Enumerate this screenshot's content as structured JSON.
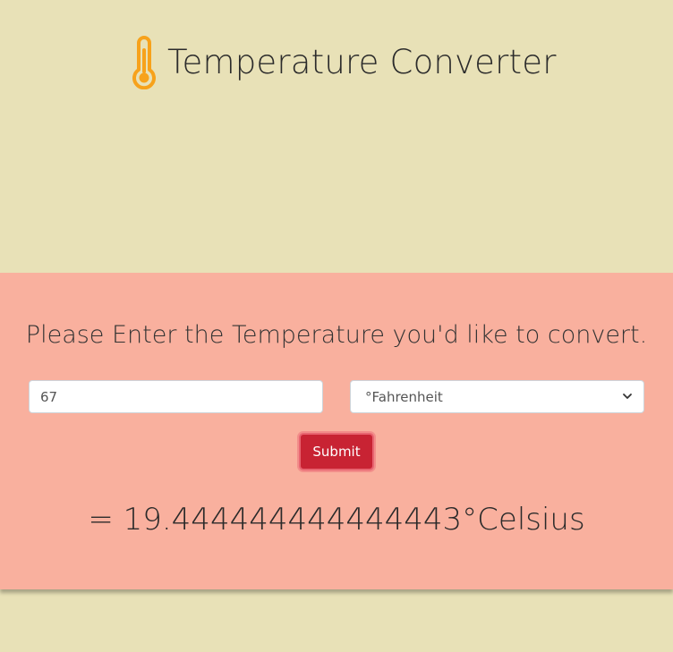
{
  "header": {
    "title": "Temperature Converter",
    "icon": "thermometer-icon"
  },
  "form": {
    "prompt": "Please Enter the Temperature you'd like to convert.",
    "temperature_value": "67",
    "unit_selected": "°Fahrenheit",
    "submit_label": "Submit"
  },
  "result": {
    "text": "= 19.444444444444443°Celsius"
  },
  "colors": {
    "header_bg": "#e8e1b7",
    "panel_bg": "#f9b09e",
    "submit_bg": "#c82333",
    "icon": "#f7a21b"
  }
}
